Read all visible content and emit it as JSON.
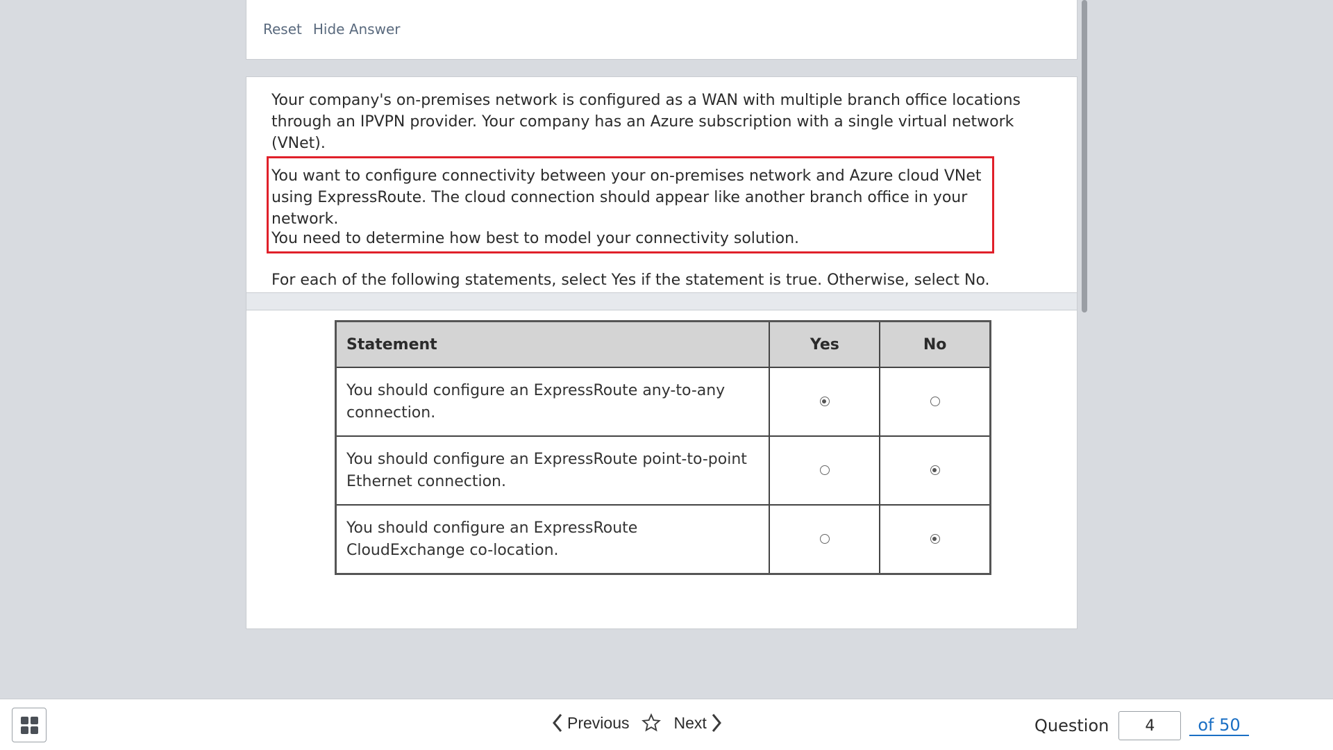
{
  "top": {
    "reset_label": "Reset",
    "hide_answer_label": "Hide Answer"
  },
  "question": {
    "paragraph1": "Your company's on-premises network is configured as a WAN with multiple branch office locations through an IPVPN provider. Your company has an Azure subscription with a single virtual network (VNet).",
    "paragraph2": "You want to configure connectivity between your on-premises network and Azure cloud VNet using ExpressRoute. The cloud connection should appear like another branch office in your network.",
    "paragraph3": "You need to determine how best to model your connectivity solution.",
    "paragraph4": "For each of the following statements, select Yes if the statement is true. Otherwise, select No."
  },
  "table": {
    "headers": [
      "Statement",
      "Yes",
      "No"
    ],
    "rows": [
      {
        "statement": "You should configure an ExpressRoute any-to-any connection.",
        "selected": "Yes"
      },
      {
        "statement": "You should configure an ExpressRoute point-to-point Ethernet connection.",
        "selected": "No"
      },
      {
        "statement": "You should configure an ExpressRoute CloudExchange co-location.",
        "selected": "No"
      }
    ]
  },
  "footer": {
    "previous_label": "Previous",
    "next_label": "Next",
    "question_label": "Question",
    "current_question": "4",
    "total_label": "of 50"
  },
  "colors": {
    "highlight_border": "#e0202a",
    "link_blue": "#1a6fc4"
  }
}
